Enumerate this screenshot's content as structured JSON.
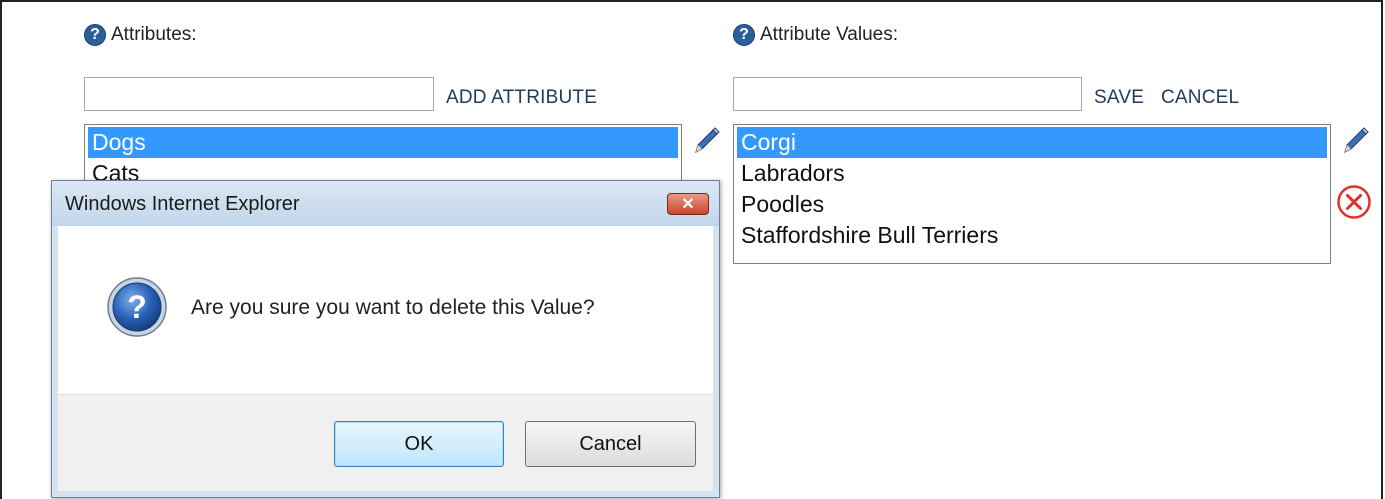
{
  "attributes": {
    "header": "Attributes:",
    "input_value": "",
    "add_label": "ADD ATTRIBUTE",
    "items": [
      {
        "label": "Dogs",
        "selected": true
      },
      {
        "label": "Cats",
        "selected": false
      }
    ]
  },
  "values": {
    "header": "Attribute Values:",
    "input_value": "",
    "save_label": "SAVE",
    "cancel_label": "CANCEL",
    "items": [
      {
        "label": "Corgi",
        "selected": true
      },
      {
        "label": "Labradors",
        "selected": false
      },
      {
        "label": "Poodles",
        "selected": false
      },
      {
        "label": "Staffordshire Bull Terriers",
        "selected": false
      }
    ]
  },
  "dialog": {
    "title": "Windows Internet Explorer",
    "message": "Are you sure you want to delete this Value?",
    "ok_label": "OK",
    "cancel_label": "Cancel"
  },
  "icons": {
    "help": "help-icon",
    "edit": "pencil-icon",
    "delete": "delete-icon",
    "question": "question-icon"
  },
  "colors": {
    "selection": "#3399ff",
    "link": "#243a59",
    "delete_red": "#e0302b"
  }
}
